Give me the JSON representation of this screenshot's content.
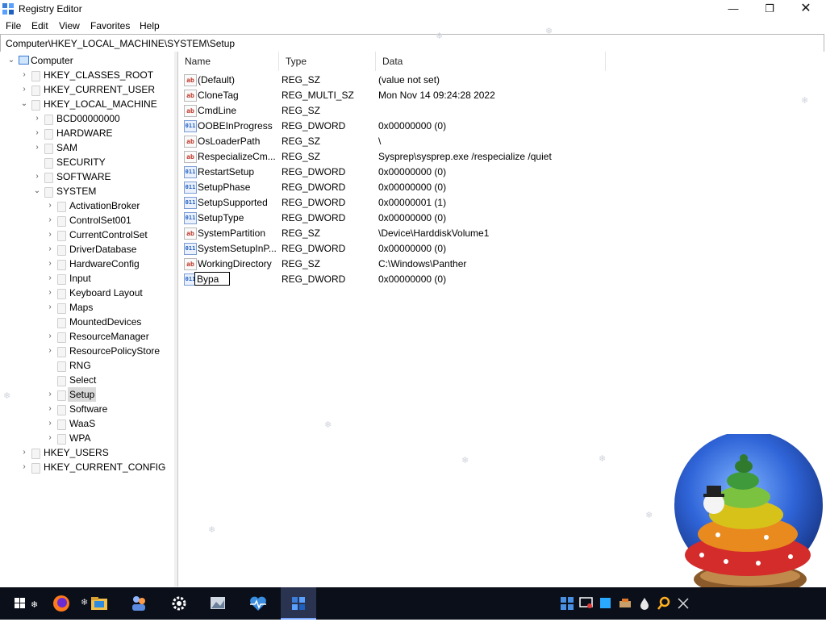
{
  "window": {
    "title": "Registry Editor",
    "controls": {
      "minimize": "—",
      "maximize": "❐",
      "close": "✕"
    }
  },
  "menu": [
    "File",
    "Edit",
    "View",
    "Favorites",
    "Help"
  ],
  "address": "Computer\\HKEY_LOCAL_MACHINE\\SYSTEM\\Setup",
  "tree": [
    {
      "label": "Computer",
      "level": 0,
      "expander": "expanded",
      "icon": "computer-icon"
    },
    {
      "label": "HKEY_CLASSES_ROOT",
      "level": 1,
      "expander": "collapsed"
    },
    {
      "label": "HKEY_CURRENT_USER",
      "level": 1,
      "expander": "collapsed"
    },
    {
      "label": "HKEY_LOCAL_MACHINE",
      "level": 1,
      "expander": "expanded"
    },
    {
      "label": "BCD00000000",
      "level": 2,
      "expander": "collapsed"
    },
    {
      "label": "HARDWARE",
      "level": 2,
      "expander": "collapsed"
    },
    {
      "label": "SAM",
      "level": 2,
      "expander": "collapsed"
    },
    {
      "label": "SECURITY",
      "level": 2,
      "expander": "none"
    },
    {
      "label": "SOFTWARE",
      "level": 2,
      "expander": "collapsed"
    },
    {
      "label": "SYSTEM",
      "level": 2,
      "expander": "expanded"
    },
    {
      "label": "ActivationBroker",
      "level": 3,
      "expander": "collapsed"
    },
    {
      "label": "ControlSet001",
      "level": 3,
      "expander": "collapsed"
    },
    {
      "label": "CurrentControlSet",
      "level": 3,
      "expander": "collapsed"
    },
    {
      "label": "DriverDatabase",
      "level": 3,
      "expander": "collapsed"
    },
    {
      "label": "HardwareConfig",
      "level": 3,
      "expander": "collapsed"
    },
    {
      "label": "Input",
      "level": 3,
      "expander": "collapsed"
    },
    {
      "label": "Keyboard Layout",
      "level": 3,
      "expander": "collapsed"
    },
    {
      "label": "Maps",
      "level": 3,
      "expander": "collapsed"
    },
    {
      "label": "MountedDevices",
      "level": 3,
      "expander": "none"
    },
    {
      "label": "ResourceManager",
      "level": 3,
      "expander": "collapsed"
    },
    {
      "label": "ResourcePolicyStore",
      "level": 3,
      "expander": "collapsed"
    },
    {
      "label": "RNG",
      "level": 3,
      "expander": "none"
    },
    {
      "label": "Select",
      "level": 3,
      "expander": "none"
    },
    {
      "label": "Setup",
      "level": 3,
      "expander": "collapsed",
      "selected": true
    },
    {
      "label": "Software",
      "level": 3,
      "expander": "collapsed"
    },
    {
      "label": "WaaS",
      "level": 3,
      "expander": "collapsed"
    },
    {
      "label": "WPA",
      "level": 3,
      "expander": "collapsed"
    },
    {
      "label": "HKEY_USERS",
      "level": 1,
      "expander": "collapsed"
    },
    {
      "label": "HKEY_CURRENT_CONFIG",
      "level": 1,
      "expander": "collapsed"
    }
  ],
  "columns": [
    "Name",
    "Type",
    "Data"
  ],
  "values": [
    {
      "name": "(Default)",
      "type": "REG_SZ",
      "data": "(value not set)",
      "icon": "string-value-icon"
    },
    {
      "name": "CloneTag",
      "type": "REG_MULTI_SZ",
      "data": "Mon Nov 14 09:24:28 2022",
      "icon": "string-value-icon"
    },
    {
      "name": "CmdLine",
      "type": "REG_SZ",
      "data": "",
      "icon": "string-value-icon"
    },
    {
      "name": "OOBEInProgress",
      "type": "REG_DWORD",
      "data": "0x00000000 (0)",
      "icon": "binary-value-icon"
    },
    {
      "name": "OsLoaderPath",
      "type": "REG_SZ",
      "data": "\\",
      "icon": "string-value-icon"
    },
    {
      "name": "RespecializeCm...",
      "type": "REG_SZ",
      "data": "Sysprep\\sysprep.exe /respecialize /quiet",
      "icon": "string-value-icon"
    },
    {
      "name": "RestartSetup",
      "type": "REG_DWORD",
      "data": "0x00000000 (0)",
      "icon": "binary-value-icon"
    },
    {
      "name": "SetupPhase",
      "type": "REG_DWORD",
      "data": "0x00000000 (0)",
      "icon": "binary-value-icon"
    },
    {
      "name": "SetupSupported",
      "type": "REG_DWORD",
      "data": "0x00000001 (1)",
      "icon": "binary-value-icon"
    },
    {
      "name": "SetupType",
      "type": "REG_DWORD",
      "data": "0x00000000 (0)",
      "icon": "binary-value-icon"
    },
    {
      "name": "SystemPartition",
      "type": "REG_SZ",
      "data": "\\Device\\HarddiskVolume1",
      "icon": "string-value-icon"
    },
    {
      "name": "SystemSetupInP...",
      "type": "REG_DWORD",
      "data": "0x00000000 (0)",
      "icon": "binary-value-icon"
    },
    {
      "name": "WorkingDirectory",
      "type": "REG_SZ",
      "data": "C:\\Windows\\Panther",
      "icon": "string-value-icon"
    },
    {
      "name": "Bypa",
      "type": "REG_DWORD",
      "data": "0x00000000 (0)",
      "icon": "binary-value-icon",
      "editing": true
    }
  ],
  "icons": {
    "string_glyph": "ab",
    "binary_glyph": "011"
  },
  "taskbar": {
    "apps": [
      "start-icon",
      "firefox-icon",
      "file-explorer-icon",
      "people-app-icon",
      "settings-icon",
      "photos-icon",
      "health-app-icon",
      "registry-editor-icon"
    ],
    "tray": [
      "tiles-icon",
      "display-icon",
      "window-icon",
      "tools-icon",
      "drop-icon",
      "search-tool-icon",
      "network-icon"
    ]
  },
  "colors": {
    "accent": "#0078d7",
    "taskbar": "#0b0f1a",
    "selection": "#d9d9d9"
  }
}
